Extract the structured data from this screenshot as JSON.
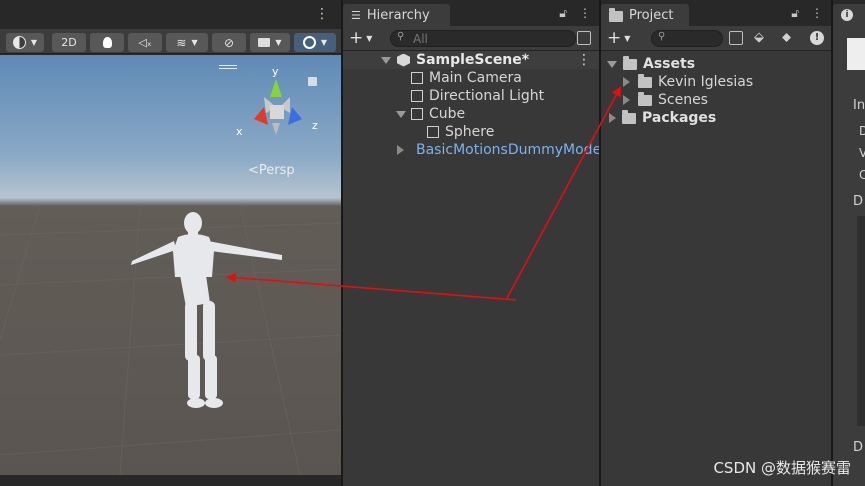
{
  "scene_view": {
    "toolbar": {
      "mode_2d_label": "2D"
    },
    "persp_label": "Persp",
    "gizmo": {
      "x_label": "x",
      "y_label": "y",
      "z_label": "z"
    }
  },
  "hierarchy": {
    "tab_label": "Hierarchy",
    "search_placeholder": "All",
    "items": [
      {
        "label": "SampleScene*",
        "depth": 0,
        "kind": "scene"
      },
      {
        "label": "Main Camera",
        "depth": 1,
        "kind": "gameobject"
      },
      {
        "label": "Directional Light",
        "depth": 1,
        "kind": "gameobject"
      },
      {
        "label": "Cube",
        "depth": 1,
        "kind": "gameobject"
      },
      {
        "label": "Sphere",
        "depth": 2,
        "kind": "gameobject"
      },
      {
        "label": "BasicMotionsDummyModel",
        "depth": 1,
        "kind": "prefab"
      }
    ]
  },
  "project": {
    "tab_label": "Project",
    "tree": [
      {
        "label": "Assets",
        "depth": 0
      },
      {
        "label": "Kevin Iglesias",
        "depth": 1
      },
      {
        "label": "Scenes",
        "depth": 1
      },
      {
        "label": "Packages",
        "depth": 0
      }
    ]
  },
  "inspector": {
    "partial_labels": [
      "In",
      "D",
      "V",
      "C",
      "D",
      "D"
    ]
  },
  "watermark": "CSDN @数据猴赛雷",
  "colors": {
    "panel_bg": "#383838",
    "tab_bar_bg": "#282828",
    "sky_top": "#5f8ab6",
    "ground": "#5a5550",
    "arrow_red": "#e01010",
    "prefab_blue": "#7ab2f0",
    "gizmo_x": "#e03a2a",
    "gizmo_y": "#8ad23c",
    "gizmo_z": "#3a6fe0"
  }
}
